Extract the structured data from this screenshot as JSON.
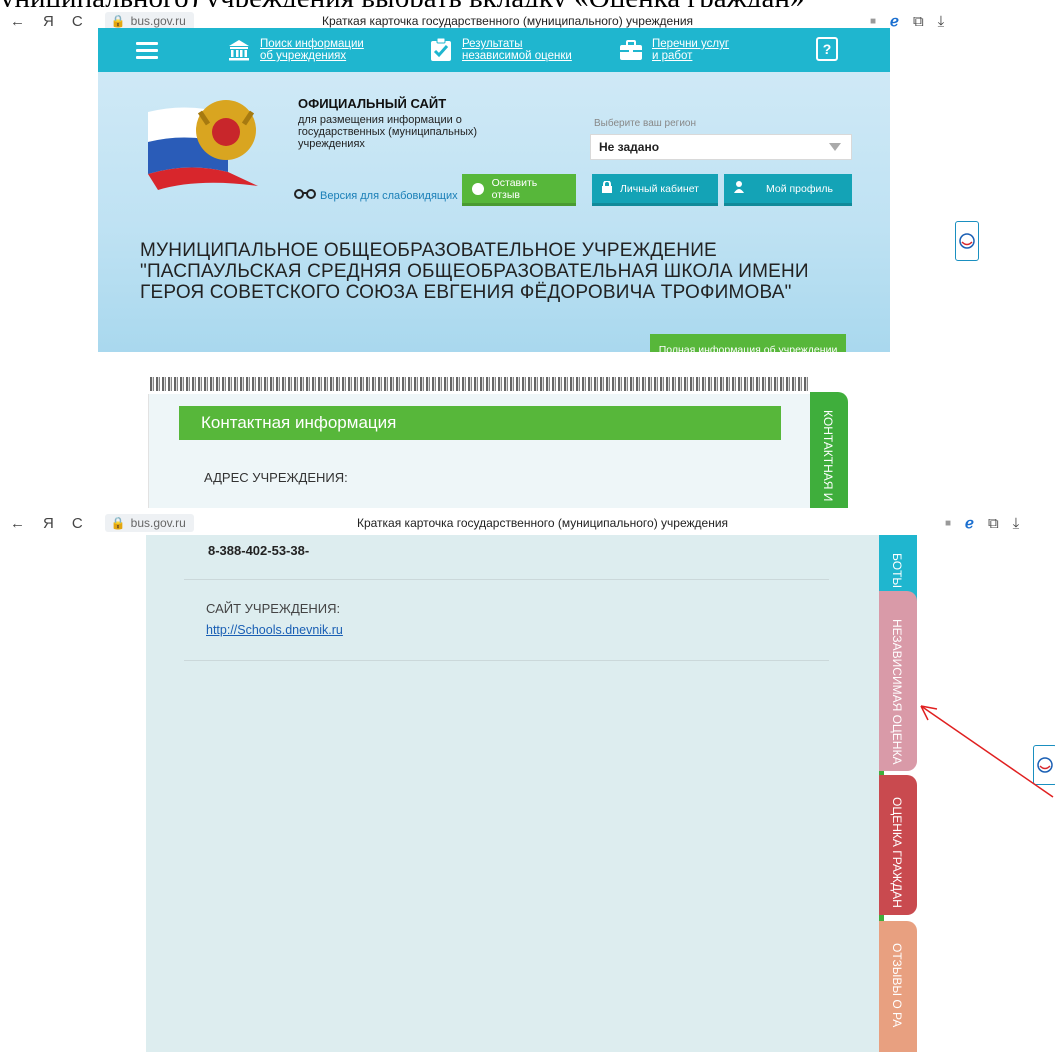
{
  "doc_text": "униципального) учреждения выбрать вкладку «Оценка граждан»",
  "browser": {
    "nav": {
      "back": "←",
      "yandex": "Я",
      "reload": "C"
    },
    "url": "bus.gov.ru",
    "page_title": "Краткая карточка государственного (муниципального) учреждения",
    "right_icons": {
      "bookmark": "■",
      "ie": "ℯ",
      "tabs": "⧉",
      "download": "⤓"
    }
  },
  "topnav": {
    "item1": "Поиск информации об учреждениях",
    "item2": "Результаты независимой оценки",
    "item3": "Перечни услуг и работ",
    "help": "?"
  },
  "header": {
    "title": "ОФИЦИАЛЬНЫЙ САЙТ",
    "subtitle": "для размещения информации о государственных (муниципальных) учреждениях",
    "vision": "Версия для слабовидящих",
    "region_label": "Выберите ваш регион",
    "region_value": "Не задано",
    "btn_feedback": "Оставить отзыв",
    "btn_cabinet": "Личный кабинет",
    "btn_profile": "Мой профиль"
  },
  "institution": {
    "name": "МУНИЦИПАЛЬНОЕ ОБЩЕОБРАЗОВАТЕЛЬНОЕ УЧРЕЖДЕНИЕ \"ПАСПАУЛЬСКАЯ СРЕДНЯЯ ОБЩЕОБРАЗОВАТЕЛЬНАЯ ШКОЛА ИМЕНИ ГЕРОЯ СОВЕТСКОГО СОЮЗА ЕВГЕНИЯ ФЁДОРОВИЧА ТРОФИМОВА\"",
    "full_info_button": "Полная информация об учреждении"
  },
  "contact": {
    "header": "Контактная информация",
    "address_label": "АДРЕС УЧРЕЖДЕНИЯ:",
    "phone": "8-388-402-53-38-",
    "site_label": "САЙТ УЧРЕЖДЕНИЯ:",
    "site_url": "http://Schools.dnevnik.ru"
  },
  "tabs": {
    "contact": "КОНТАКТНАЯ И",
    "works": "БОТЫ",
    "independent": "НЕЗАВИСИМАЯ ОЦЕНКА",
    "citizens": "ОЦЕНКА ГРАЖДАН",
    "reviews": "ОТЗЫВЫ О РА"
  },
  "colors": {
    "topnav": "#1fb6cf",
    "green": "#57b73a",
    "teal": "#14a3b6",
    "tab_pink": "#d99aa8",
    "tab_red": "#c94a4f",
    "tab_orange": "#e8a080",
    "arrow": "#e02020"
  }
}
